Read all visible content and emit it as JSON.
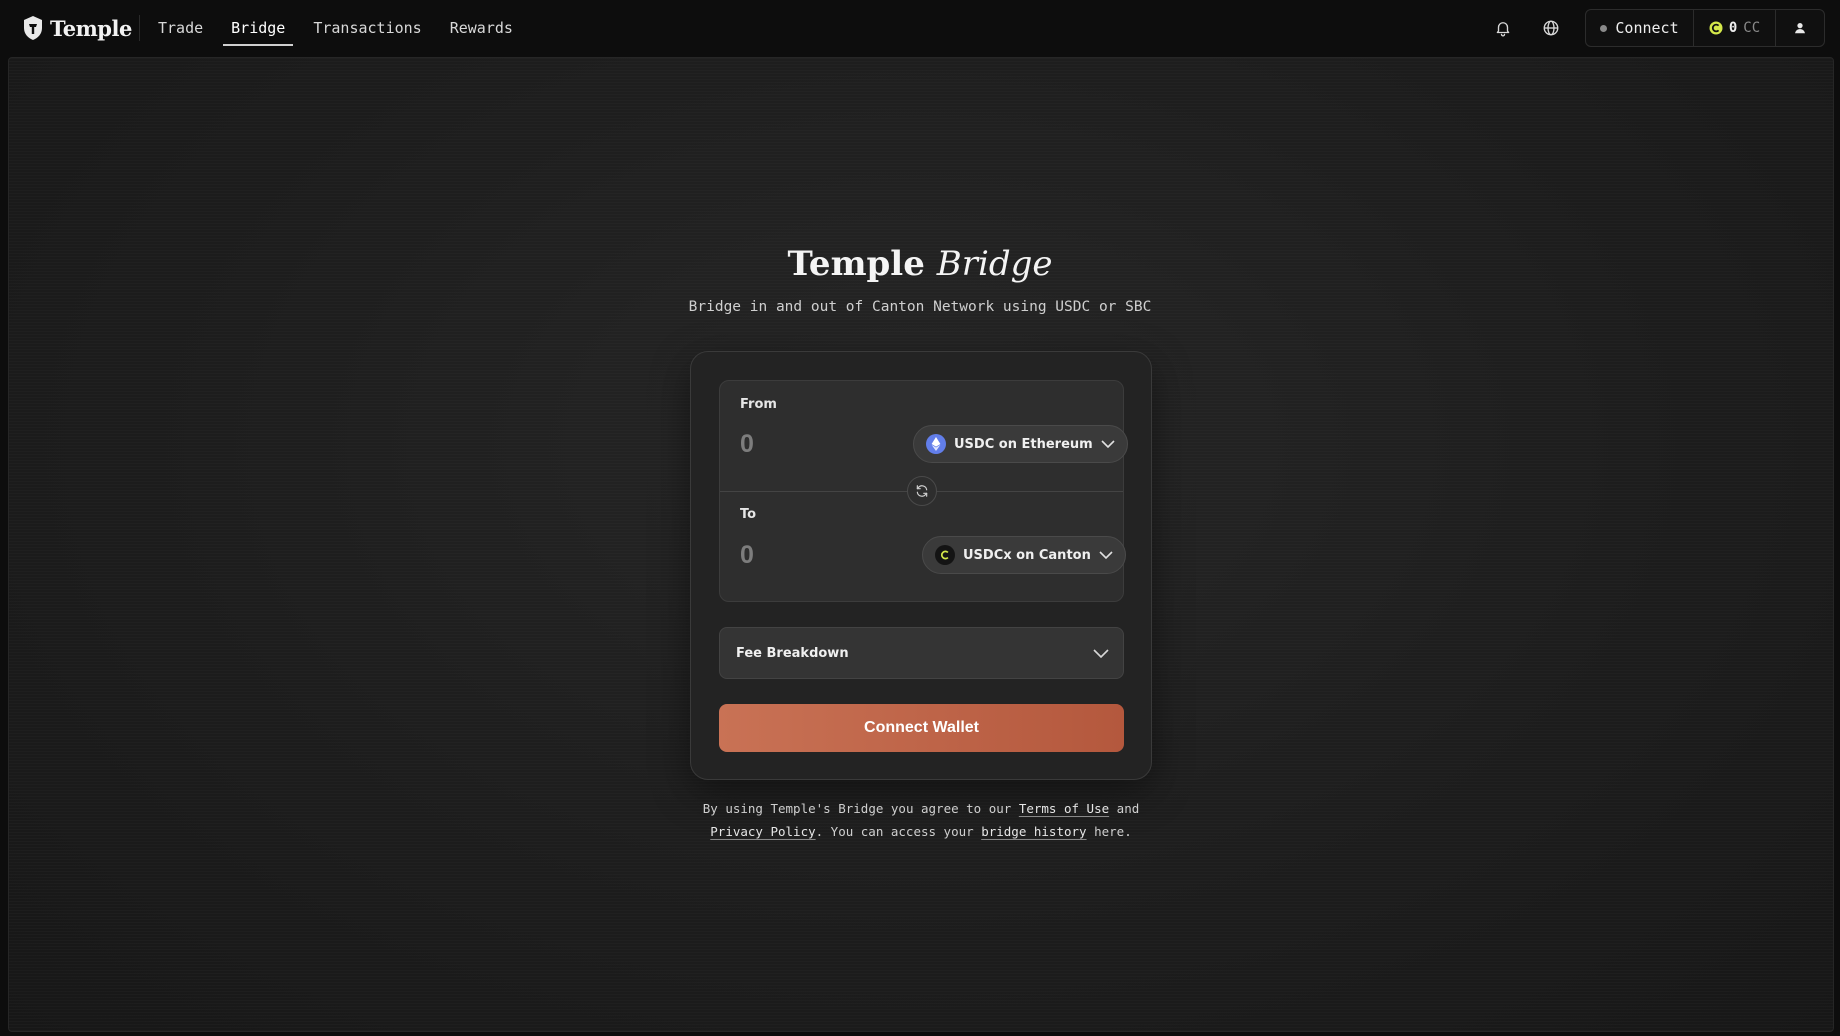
{
  "brand": {
    "name": "Temple",
    "logo_icon": "temple-logo-icon"
  },
  "nav": {
    "items": [
      {
        "label": "Trade",
        "active": false
      },
      {
        "label": "Bridge",
        "active": true
      },
      {
        "label": "Transactions",
        "active": false
      },
      {
        "label": "Rewards",
        "active": false
      }
    ]
  },
  "header": {
    "icons": [
      "bell-icon",
      "globe-icon",
      "user-icon"
    ],
    "connect_label": "Connect",
    "balance_value": "0",
    "balance_unit": "CC"
  },
  "hero": {
    "title_main": "Temple",
    "title_italic": "Bridge",
    "subtitle": "Bridge in and out of Canton Network using USDC or SBC"
  },
  "bridge": {
    "from": {
      "label": "From",
      "placeholder": "0",
      "token_label": "USDC on Ethereum",
      "token_icon": "ethereum-icon"
    },
    "to": {
      "label": "To",
      "placeholder": "0",
      "token_label": "USDCx on Canton",
      "token_icon": "canton-icon"
    },
    "fee_label": "Fee Breakdown",
    "cta_label": "Connect Wallet"
  },
  "legal": {
    "prefix": "By using Temple's Bridge you agree to our ",
    "terms": "Terms of Use",
    "and": " and ",
    "privacy": "Privacy Policy",
    "middle": ". You can access your ",
    "history": "bridge history",
    "suffix": " here."
  },
  "colors": {
    "accent_start": "#c97255",
    "accent_end": "#b4583d",
    "ethereum": "#627eea",
    "canton": "#d4e84a"
  }
}
